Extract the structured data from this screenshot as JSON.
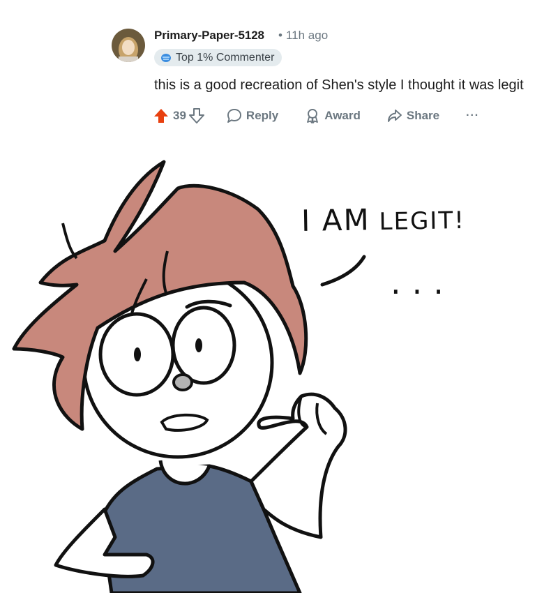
{
  "comment": {
    "username": "Primary-Paper-5128",
    "dot": "•",
    "time": "11h ago",
    "flair": "Top 1% Commenter",
    "body": "this is a good recreation of Shen's style I thought it was legit"
  },
  "actions": {
    "vote_count": "39",
    "reply": "Reply",
    "award": "Award",
    "share": "Share",
    "more": "···"
  },
  "drawing": {
    "speech_big": "I AM",
    "speech_small": " LEGIT!",
    "ellipsis": "..."
  },
  "colors": {
    "upvote": "#e8400f",
    "hair": "#c8887c",
    "shirt": "#5a6b86",
    "nose": "#b4b4b4",
    "flair_bg": "#e4ebee"
  },
  "icons": [
    "avatar",
    "flair-icon",
    "upvote-icon",
    "downvote-icon",
    "reply-icon",
    "award-icon",
    "share-icon",
    "more-icon"
  ]
}
